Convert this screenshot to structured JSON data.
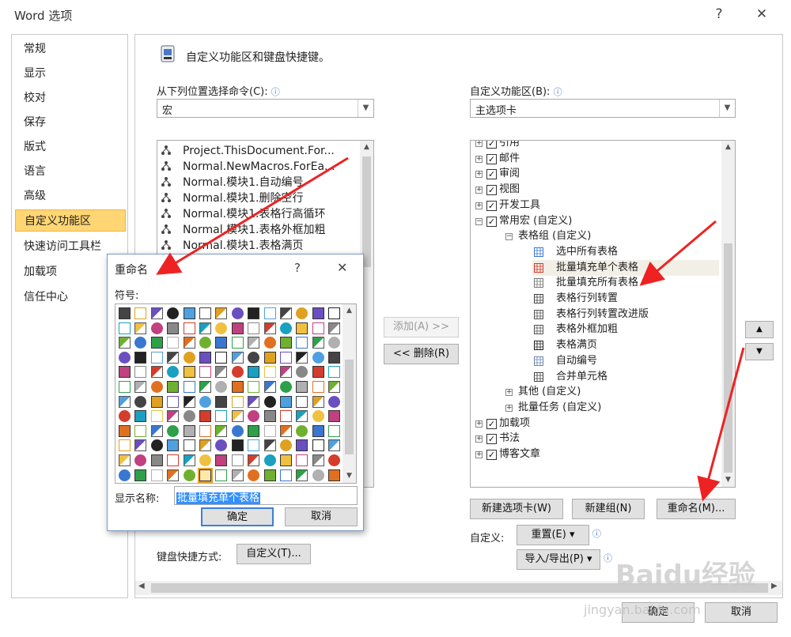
{
  "window": {
    "title": "Word 选项",
    "help": "?",
    "close": "✕"
  },
  "nav": {
    "items": [
      {
        "label": "常规"
      },
      {
        "label": "显示"
      },
      {
        "label": "校对"
      },
      {
        "label": "保存"
      },
      {
        "label": "版式"
      },
      {
        "label": "语言"
      },
      {
        "label": "高级"
      },
      {
        "label": "自定义功能区"
      },
      {
        "label": "快速访问工具栏"
      },
      {
        "label": "加载项"
      },
      {
        "label": "信任中心"
      }
    ],
    "active_index": 7
  },
  "panel": {
    "heading": "自定义功能区和键盘快捷键。",
    "left_label": "从下列位置选择命令(C):",
    "left_combo_value": "宏",
    "right_label": "自定义功能区(B):",
    "right_combo_value": "主选项卡",
    "commands": [
      "Project.ThisDocument.For...",
      "Normal.NewMacros.ForEa...",
      "Normal.模块1.自动编号",
      "Normal.模块1.删除空行",
      "Normal.模块1.表格行高循环",
      "Normal.模块1.表格外框加粗",
      "Normal.模块1.表格满页"
    ],
    "add_button": "添加(A) >>",
    "remove_button": "<< 删除(R)",
    "tree": [
      {
        "label": "引用",
        "level": 0,
        "checked": true
      },
      {
        "label": "邮件",
        "level": 0,
        "checked": true
      },
      {
        "label": "审阅",
        "level": 0,
        "checked": true
      },
      {
        "label": "视图",
        "level": 0,
        "checked": true
      },
      {
        "label": "开发工具",
        "level": 0,
        "checked": true
      },
      {
        "label": "常用宏 (自定义)",
        "level": 0,
        "checked": true
      },
      {
        "label": "表格组 (自定义)",
        "level": 1
      },
      {
        "label": "选中所有表格",
        "level": 2
      },
      {
        "label": "批量填充单个表格",
        "level": 2
      },
      {
        "label": "批量填充所有表格",
        "level": 2
      },
      {
        "label": "表格行列转置",
        "level": 2
      },
      {
        "label": "表格行列转置改进版",
        "level": 2
      },
      {
        "label": "表格外框加粗",
        "level": 2
      },
      {
        "label": "表格满页",
        "level": 2
      },
      {
        "label": "自动编号",
        "level": 2
      },
      {
        "label": "合并单元格",
        "level": 2
      },
      {
        "label": "其他 (自定义)",
        "level": 1
      },
      {
        "label": "批量任务 (自定义)",
        "level": 1
      },
      {
        "label": "加载项",
        "level": 0,
        "checked": true
      },
      {
        "label": "书法",
        "level": 0,
        "checked": true
      },
      {
        "label": "博客文章",
        "level": 0,
        "checked": true
      }
    ],
    "new_tab_button": "新建选项卡(W)",
    "new_group_button": "新建组(N)",
    "rename_button": "重命名(M)...",
    "customize_label": "自定义:",
    "reset_button": "重置(E) ▾",
    "import_export_button": "导入/导出(P) ▾",
    "keyboard_label": "键盘快捷方式:",
    "keyboard_button": "自定义(T)...",
    "ok_button": "确定",
    "cancel_button": "取消"
  },
  "rename_dialog": {
    "title": "重命名",
    "help": "?",
    "close": "✕",
    "symbol_label": "符号:",
    "display_name_label": "显示名称:",
    "display_name_value": "批量填充单个表格",
    "ok_button": "确定",
    "cancel_button": "取消"
  },
  "watermark": {
    "brand": "Baidu经验",
    "url": "jingyan.baidu.com"
  },
  "colors": {
    "accent_selected": "#ffd673",
    "arrow_red": "#ee2222",
    "dialog_border": "#7a9cc5"
  }
}
